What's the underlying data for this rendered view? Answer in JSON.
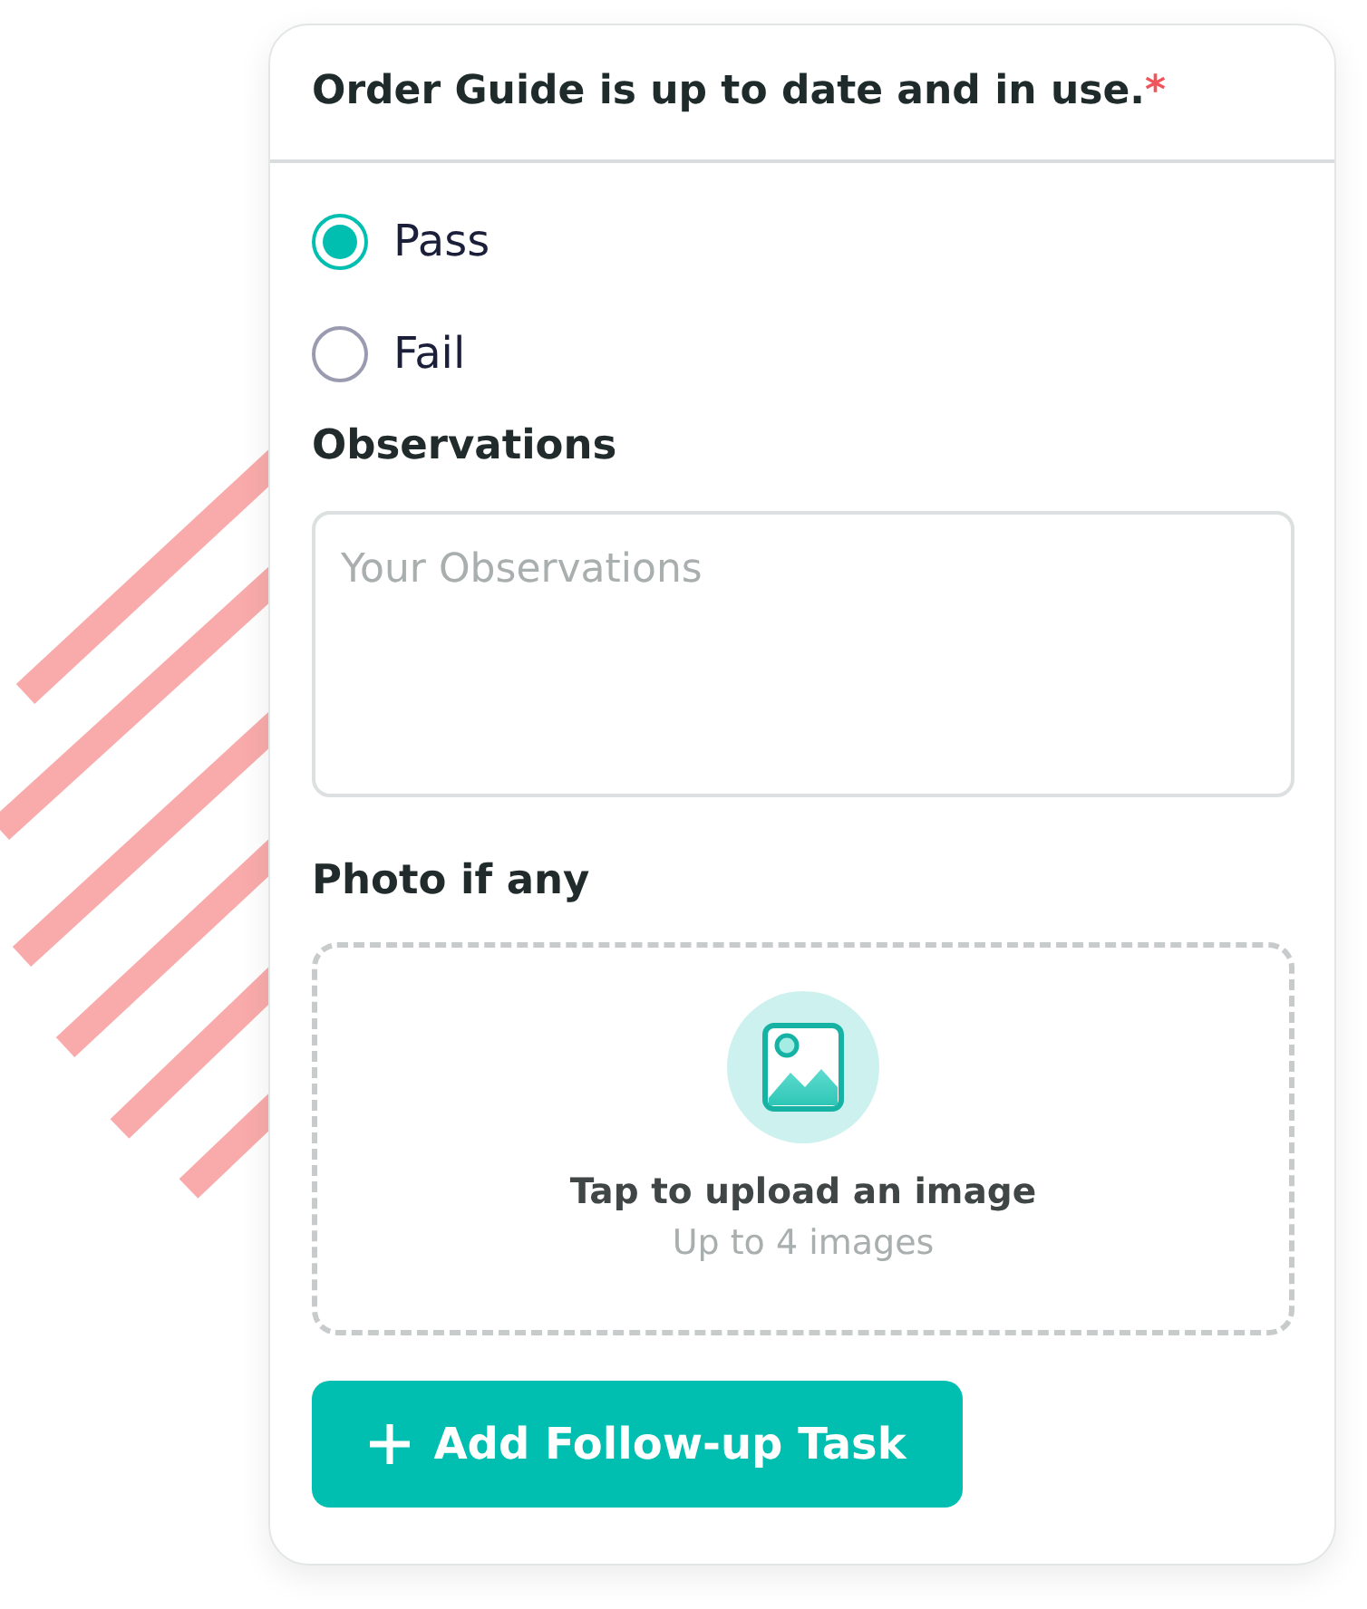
{
  "question": {
    "title": "Order Guide is up to date and in use.",
    "required_mark": "*"
  },
  "options": [
    {
      "label": "Pass",
      "selected": true
    },
    {
      "label": "Fail",
      "selected": false
    }
  ],
  "observations": {
    "label": "Observations",
    "placeholder": "Your Observations"
  },
  "photo": {
    "label": "Photo if any",
    "upload_title": "Tap to upload an image",
    "upload_hint": "Up to 4 images"
  },
  "button": {
    "label": "Add Follow-up Task"
  }
}
